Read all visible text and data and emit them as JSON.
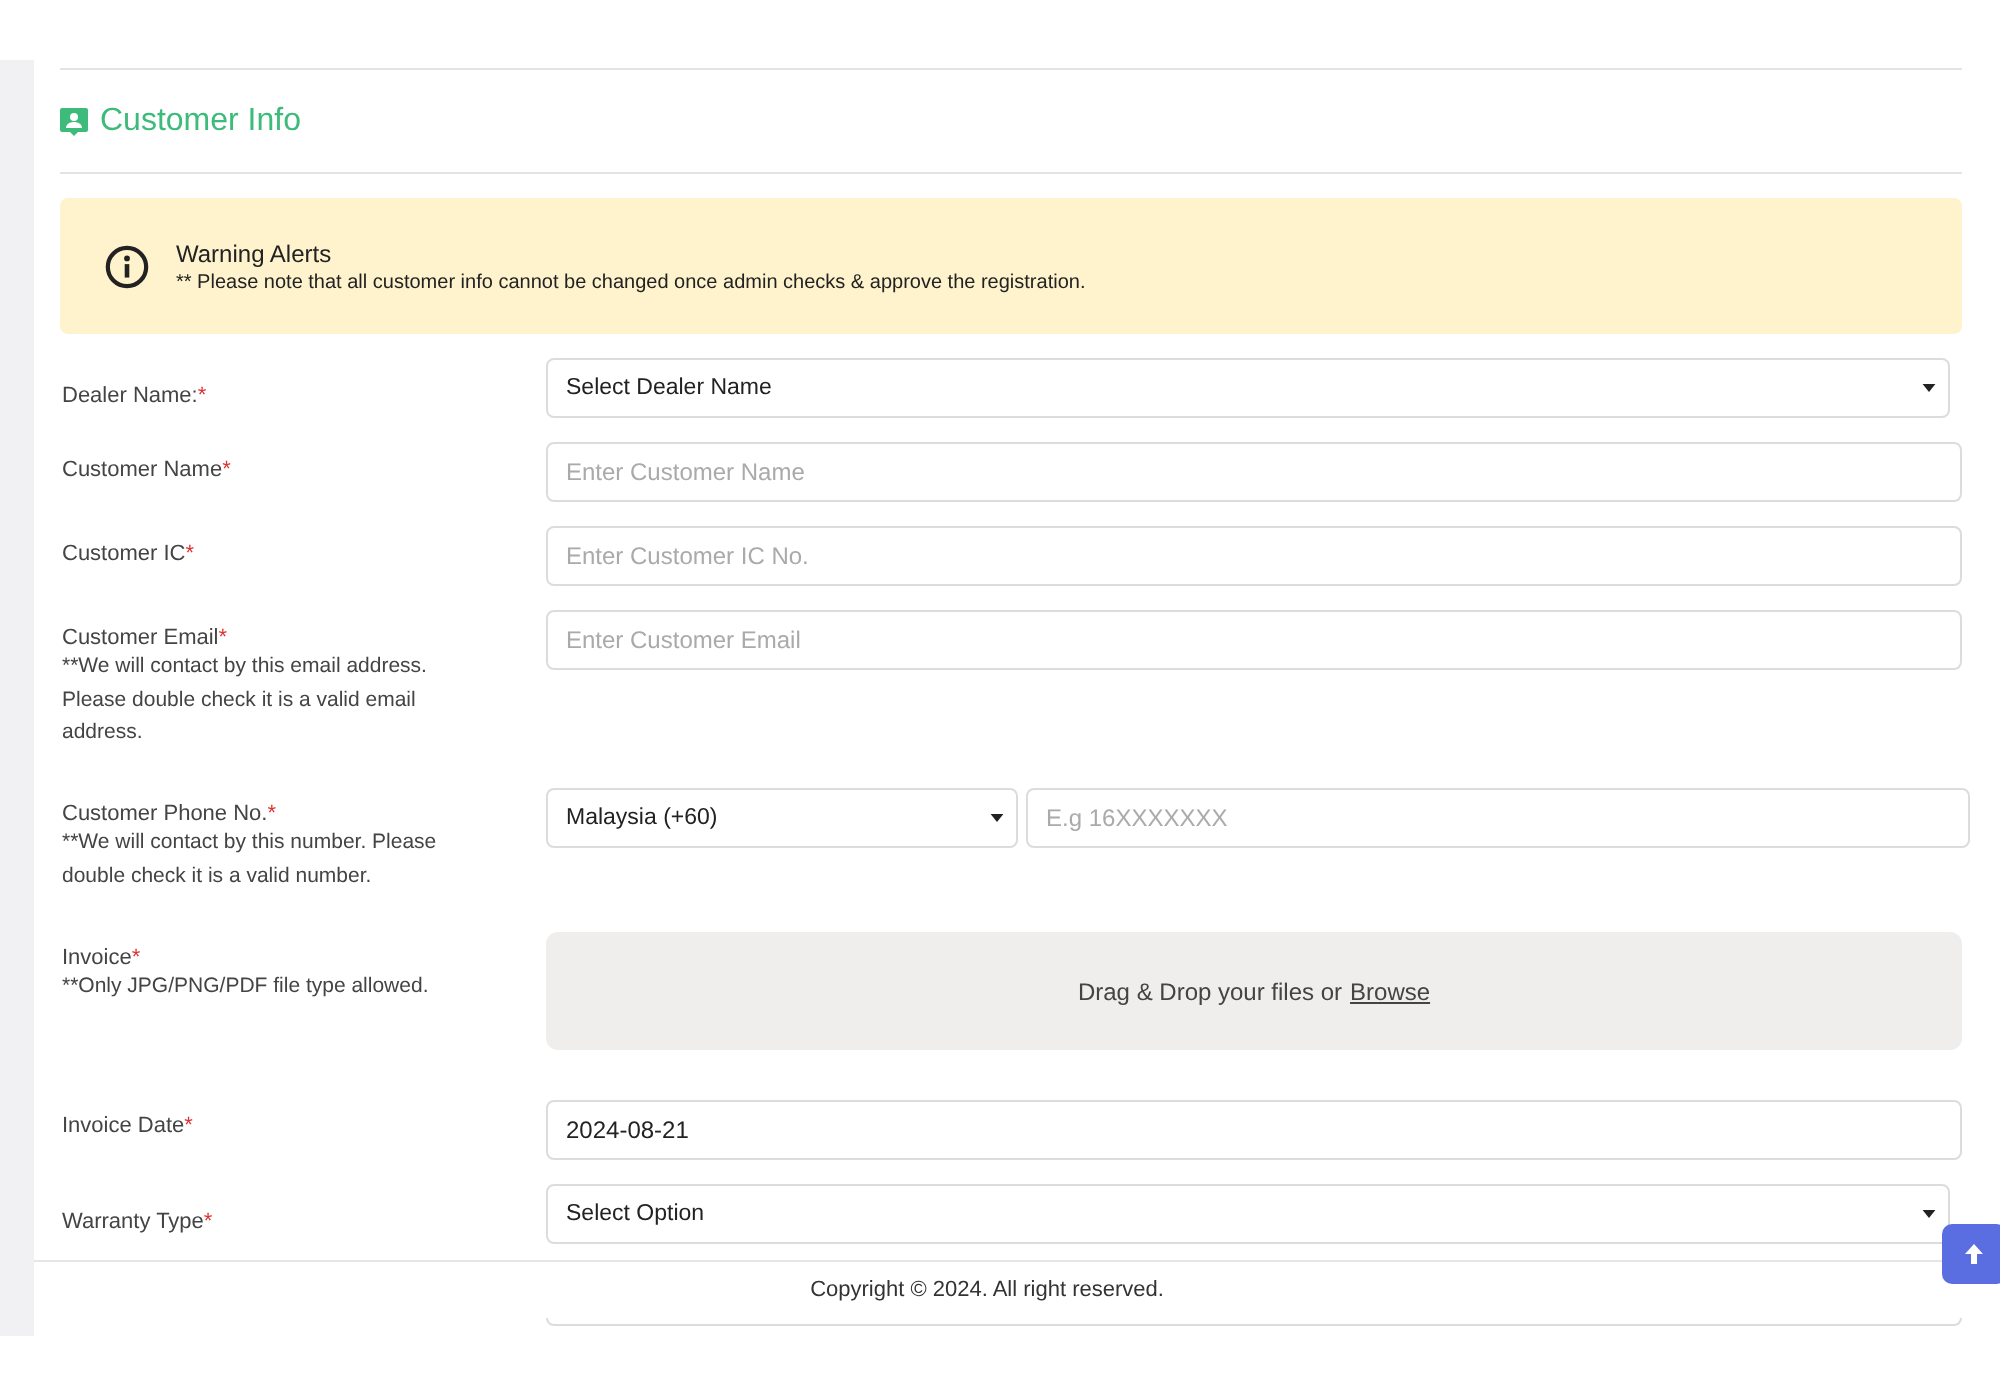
{
  "section": {
    "title": "Customer Info"
  },
  "alert": {
    "title": "Warning Alerts",
    "message": "** Please note that all customer info cannot be changed once admin checks & approve the registration."
  },
  "fields": [
    {
      "kind": "select",
      "label": "Dealer Name:",
      "required_mark": "*",
      "value": "Select Dealer Name"
    },
    {
      "kind": "text",
      "label": "Customer Name",
      "required_mark": "*",
      "placeholder": "Enter Customer Name"
    },
    {
      "kind": "text",
      "label": "Customer IC",
      "required_mark": "*",
      "placeholder": "Enter Customer IC No."
    },
    {
      "kind": "text",
      "label": "Customer Email",
      "required_mark": "*",
      "hint": "**We will contact by this email address. Please double check it is a valid email address.",
      "placeholder": "Enter Customer Email"
    },
    {
      "kind": "phone",
      "label": "Customer Phone No.",
      "required_mark": "*",
      "hint": "**We will contact by this number. Please double check it is a valid number.",
      "country": "Malaysia (+60)",
      "placeholder": "E.g 16XXXXXXX"
    },
    {
      "kind": "file",
      "label": "Invoice",
      "required_mark": "*",
      "hint": "**Only JPG/PNG/PDF file type allowed.",
      "drop_text": "Drag & Drop your files or",
      "browse": "Browse"
    },
    {
      "kind": "date",
      "label": "Invoice Date",
      "required_mark": "*",
      "value": "2024-08-21"
    },
    {
      "kind": "select",
      "label": "Warranty Type",
      "required_mark": "*",
      "value": "Select Option"
    }
  ],
  "footer": {
    "copyright": "Copyright © 2024. All right reserved."
  }
}
